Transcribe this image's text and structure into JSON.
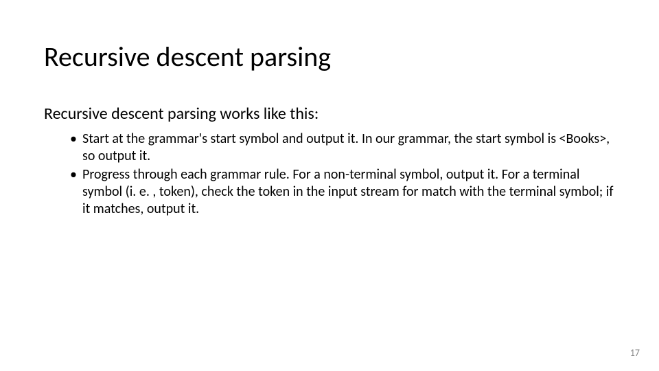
{
  "title": "Recursive descent parsing",
  "intro": "Recursive descent parsing works like this:",
  "bullets": [
    "Start at the grammar's start symbol and output it. In our grammar, the start symbol is <Books>, so output it.",
    "Progress through each grammar rule. For a non-terminal symbol, output it. For a terminal symbol (i. e. , token), check the token in the input stream for match with the terminal symbol; if it matches, output it."
  ],
  "page_number": "17"
}
